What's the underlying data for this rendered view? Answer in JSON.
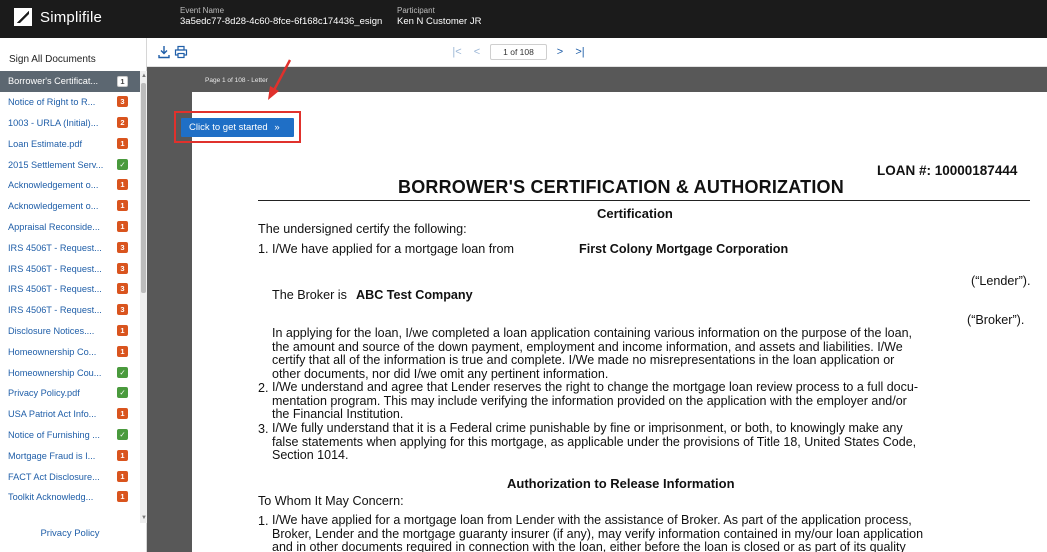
{
  "app": {
    "brand": "Simplifile",
    "event_label": "Event Name",
    "event_value": "3a5edc77-8d28-4c60-8fce-6f168c174436_esign",
    "participant_label": "Participant",
    "participant_value": "Ken N Customer JR"
  },
  "sidebar": {
    "sign_all": "Sign All Documents",
    "privacy": "Privacy Policy",
    "items": [
      {
        "label": "Borrower's Certificat...",
        "count": "1",
        "status": "active"
      },
      {
        "label": "Notice of Right to R...",
        "count": "3",
        "status": "pending"
      },
      {
        "label": "1003 - URLA (Initial)...",
        "count": "2",
        "status": "pending"
      },
      {
        "label": "Loan Estimate.pdf",
        "count": "1",
        "status": "pending"
      },
      {
        "label": "2015 Settlement Serv...",
        "count": "",
        "status": "done"
      },
      {
        "label": "Acknowledgement o...",
        "count": "1",
        "status": "pending"
      },
      {
        "label": "Acknowledgement o...",
        "count": "1",
        "status": "pending"
      },
      {
        "label": "Appraisal Reconside...",
        "count": "1",
        "status": "pending"
      },
      {
        "label": "IRS 4506T - Request...",
        "count": "3",
        "status": "pending"
      },
      {
        "label": "IRS 4506T - Request...",
        "count": "3",
        "status": "pending"
      },
      {
        "label": "IRS 4506T - Request...",
        "count": "3",
        "status": "pending"
      },
      {
        "label": "IRS 4506T - Request...",
        "count": "3",
        "status": "pending"
      },
      {
        "label": "Disclosure Notices....",
        "count": "1",
        "status": "pending"
      },
      {
        "label": "Homeownership Co...",
        "count": "1",
        "status": "pending"
      },
      {
        "label": "Homeownership Cou...",
        "count": "",
        "status": "done"
      },
      {
        "label": "Privacy Policy.pdf",
        "count": "",
        "status": "done"
      },
      {
        "label": "USA Patriot Act Info...",
        "count": "1",
        "status": "pending"
      },
      {
        "label": "Notice of Furnishing ...",
        "count": "",
        "status": "done"
      },
      {
        "label": "Mortgage Fraud is I...",
        "count": "1",
        "status": "pending"
      },
      {
        "label": "FACT Act Disclosure...",
        "count": "1",
        "status": "pending"
      },
      {
        "label": "Toolkit Acknowledg...",
        "count": "1",
        "status": "pending"
      }
    ]
  },
  "toolbar": {
    "page_indicator": "1 of 108"
  },
  "viewer": {
    "page_label": "Page 1 of 108 - Letter",
    "start_button": "Click to get started"
  },
  "document": {
    "loan_number": "LOAN #: 10000187444",
    "title": "BORROWER'S CERTIFICATION & AUTHORIZATION",
    "section1": "Certification",
    "intro": "The undersigned certify the following:",
    "item1_num": "1.",
    "item1_text": "I/We have applied for a mortgage loan from",
    "lender_name": "First Colony Mortgage Corporation",
    "lender_tag": "(“Lender”).",
    "broker_text": "The Broker is",
    "broker_name": "ABC Test Company",
    "broker_tag": "(“Broker”).",
    "para1_l1": "In applying for the loan, I/we completed a loan application containing various information on the purpose of the loan,",
    "para1_l2": "the amount and source of the down payment, employment and income information, and assets and liabilities. I/We",
    "para1_l3": "certify that all of the information is true and complete. I/We made no misrepresentations in the loan application or",
    "para1_l4": "other documents, nor did I/we omit any pertinent information.",
    "item2_num": "2.",
    "item2_l1": "I/We understand and agree that Lender reserves the right to change the mortgage loan review process to a full docu-",
    "item2_l2": "mentation program. This may include verifying the information provided on the application with the employer and/or",
    "item2_l3": "the Financial Institution.",
    "item3_num": "3.",
    "item3_l1": "I/We fully understand that it is a Federal crime punishable by fine or imprisonment, or both, to knowingly make any",
    "item3_l2": "false statements when applying for this mortgage, as applicable under the provisions of Title 18, United States Code,",
    "item3_l3": "Section 1014.",
    "section2": "Authorization to Release Information",
    "to_whom": "To Whom It May Concern:",
    "auth1_num": "1.",
    "auth1_l1": "I/We have applied for a mortgage loan from Lender with the assistance of Broker. As part of the application process,",
    "auth1_l2": "Broker, Lender and the mortgage guaranty insurer (if any), may verify information contained in my/our loan application",
    "auth1_l3": "and in other documents required in connection with the loan, either before the loan is closed or as part of its quality"
  },
  "colors": {
    "topbar": "#1b1b1b",
    "link": "#1f5ea8",
    "active_item": "#5c6771",
    "badge_pending": "#d9541e",
    "badge_done": "#4a9a3d",
    "button": "#1f6fc6",
    "highlight": "#e0312c",
    "viewer_bg": "#585858"
  },
  "icons": {
    "download": "download-icon",
    "print": "print-icon",
    "first": "first-page-icon",
    "prev": "prev-page-icon",
    "next": "next-page-icon",
    "last": "last-page-icon",
    "chevron": "double-chevron-down-icon"
  }
}
